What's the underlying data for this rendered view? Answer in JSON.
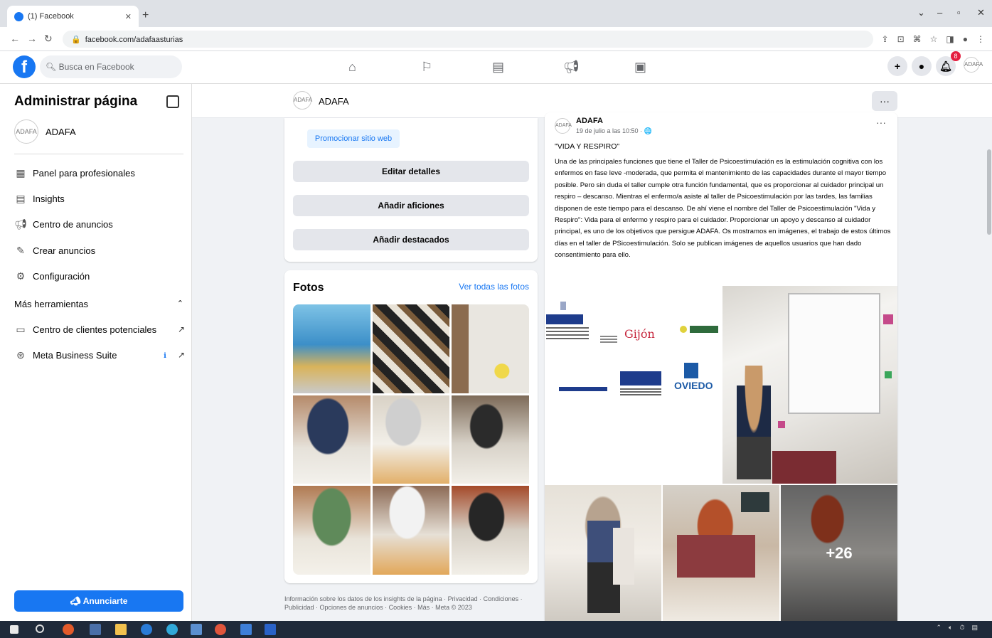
{
  "browser": {
    "tab_title": "(1) Facebook",
    "url": "facebook.com/adafaasturias"
  },
  "fb": {
    "search_placeholder": "Busca en Facebook",
    "notif_count": "8"
  },
  "sidebar": {
    "title": "Administrar página",
    "page_name": "ADAFA",
    "items": [
      {
        "label": "Panel para profesionales",
        "icon": "dashboard-icon"
      },
      {
        "label": "Insights",
        "icon": "insights-icon"
      },
      {
        "label": "Centro de anuncios",
        "icon": "megaphone-icon"
      },
      {
        "label": "Crear anuncios",
        "icon": "pencil-icon"
      },
      {
        "label": "Configuración",
        "icon": "gear-icon"
      }
    ],
    "more_tools": "Más herramientas",
    "tools": [
      {
        "label": "Centro de clientes potenciales",
        "icon": "leads-icon"
      },
      {
        "label": "Meta Business Suite",
        "icon": "meta-icon"
      }
    ],
    "promote_button": "Anunciarte"
  },
  "page_header": {
    "name": "ADAFA"
  },
  "about_card": {
    "promote_website": "Promocionar sitio web",
    "buttons": [
      "Editar detalles",
      "Añadir aficiones",
      "Añadir destacados"
    ]
  },
  "photos_card": {
    "title": "Fotos",
    "see_all": "Ver todas las fotos"
  },
  "footer_text": "Información sobre los datos de los insights de la página · Privacidad · Condiciones · Publicidad · Opciones de anuncios · Cookies · Más · Meta © 2023",
  "post": {
    "author": "ADAFA",
    "time": "19 de julio a las 10:50 · 🌐",
    "title": "\"VIDA Y RESPIRO\"",
    "body": "Una de las principales funciones que tiene el Taller de Psicoestimulación es la estimulación cognitiva con los enfermos en fase leve -moderada, que permita el mantenimiento de las capacidades durante el mayor tiempo posible. Pero sin duda el taller cumple otra función fundamental, que es proporcionar al cuidador principal un respiro – descanso. Mientras el enfermo/a asiste al taller de Psicoestimulación por las tardes, las familias disponen de este tiempo para el descanso. De ahí viene el nombre del Taller de Psicoestimulación \"Vida y Respiro\": Vida para el enfermo y respiro para el cuidador.  Proporcionar un apoyo y descanso al cuidador principal, es uno de los objetivos que persigue ADAFA. Os mostramos en imágenes, el trabajo de estos últimos días en el taller de PSicoestimulación. Solo se publican imágenes de aquellos usuarios que han dado consentimiento para ello.",
    "more_photos": "+26",
    "logos": [
      "Gijón",
      "OVIEDO"
    ]
  }
}
